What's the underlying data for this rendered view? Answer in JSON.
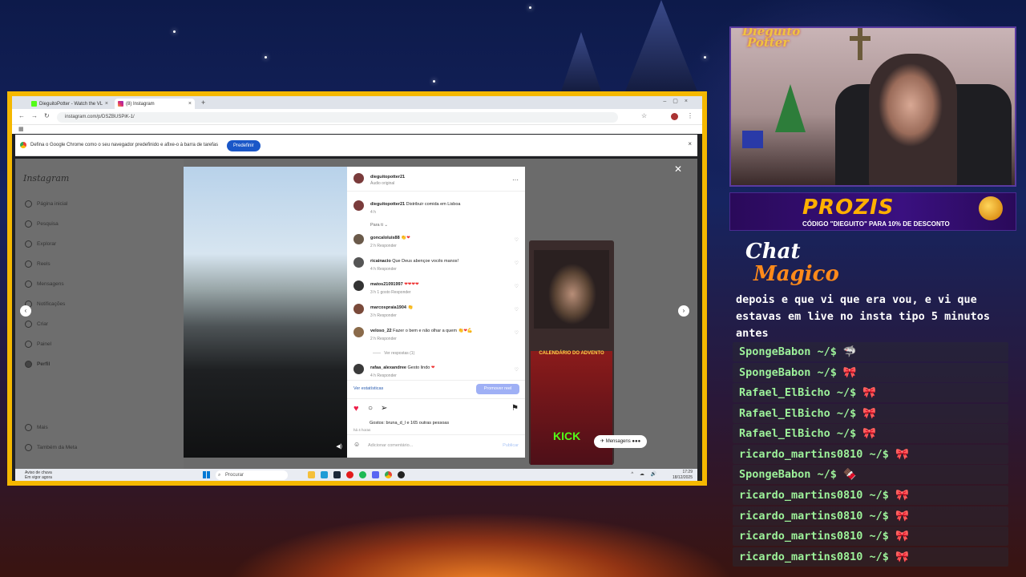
{
  "browser": {
    "tabs": [
      {
        "label": "DieguitoPotter - Watch the VL"
      },
      {
        "label": "(8) Instagram"
      }
    ],
    "new_tab": "+",
    "url": "instagram.com/p/DSZBUSPiK-1/",
    "infobar_text": "Defina o Google Chrome como o seu navegador predefinido e afixe-o à barra de tarefas",
    "infobar_button": "Predefinir"
  },
  "instagram": {
    "logo": "Instagram",
    "nav": [
      {
        "label": "Página inicial"
      },
      {
        "label": "Pesquisa"
      },
      {
        "label": "Explorar"
      },
      {
        "label": "Reels"
      },
      {
        "label": "Mensagens"
      },
      {
        "label": "Notificações"
      },
      {
        "label": "Criar"
      },
      {
        "label": "Painel"
      },
      {
        "label": "Perfil"
      },
      {
        "label": "Mais"
      },
      {
        "label": "Também da Meta"
      }
    ],
    "post_header": {
      "user": "dieguitopotter21",
      "audio": "Áudio original"
    },
    "caption": {
      "user": "dieguitopotter21",
      "text": "Distribuir comida em Lisboa",
      "time": "4 h"
    },
    "for_you": "Para ti",
    "comments": [
      {
        "user": "goncaloluis88",
        "text": "",
        "meta": "2 h   Responder"
      },
      {
        "user": "ricainacio",
        "text": "Que Deus abençoe vocês manos!",
        "meta": "4 h   Responder"
      },
      {
        "user": "matos21091997",
        "text": "",
        "meta": "3 h   1 gosto   Responder"
      },
      {
        "user": "marcospraia1904",
        "text": "",
        "meta": "3 h   Responder"
      },
      {
        "user": "veloso_22",
        "text": "Fazer o bem e não olhar a quem",
        "meta": "2 h   Responder"
      },
      {
        "user": "rafaa_alexandree",
        "text": "Gesto lindo",
        "meta": "4 h   Responder"
      }
    ],
    "see_replies": "Ver respostas (1)",
    "see_stats": "Ver estatísticas",
    "promote": "Promover reel",
    "likes": "Gostos: bruna_d_l e 165 outras pessoas",
    "ago": "há 4 horas",
    "comment_placeholder": "Adicionar comentário...",
    "publish": "Publicar",
    "messages": "Mensagens",
    "strip_caption": "CALENDÁRIO DO ADVENTO",
    "kick": "KICK"
  },
  "taskbar": {
    "weather_line1": "Aviso de chuva",
    "weather_line2": "Em vigor agora",
    "search": "Procurar",
    "time": "17:29",
    "date": "18/12/2025"
  },
  "stream": {
    "webcam_brand_line1": "Dieguito",
    "webcam_brand_line2": "Potter",
    "sponsor_logo": "PROZIS",
    "sponsor_sub": "CÓDIGO \"DIEGUITO\" PARA 10% DE DESCONTO",
    "chat_title_line1": "Chat",
    "chat_title_line2": "Magico"
  },
  "chat": {
    "partial_message": "depois e que vi que era vou, e vi que estavas em live no insta tipo 5 minutos antes",
    "messages": [
      {
        "user": "SpongeBabon ~/$",
        "emote": "🦈"
      },
      {
        "user": "SpongeBabon ~/$",
        "emote": "🎀"
      },
      {
        "user": "Rafael_ElBicho ~/$",
        "emote": "🎀"
      },
      {
        "user": "Rafael_ElBicho ~/$",
        "emote": "🎀"
      },
      {
        "user": "Rafael_ElBicho ~/$",
        "emote": "🎀"
      },
      {
        "user": "ricardo_martins0810 ~/$",
        "emote": "🎀"
      },
      {
        "user": "SpongeBabon ~/$",
        "emote": "🍫"
      },
      {
        "user": "ricardo_martins0810 ~/$",
        "emote": "🎀"
      },
      {
        "user": "ricardo_martins0810 ~/$",
        "emote": "🎀"
      },
      {
        "user": "ricardo_martins0810 ~/$",
        "emote": "🎀"
      },
      {
        "user": "ricardo_martins0810 ~/$",
        "emote": "🎀"
      }
    ]
  }
}
